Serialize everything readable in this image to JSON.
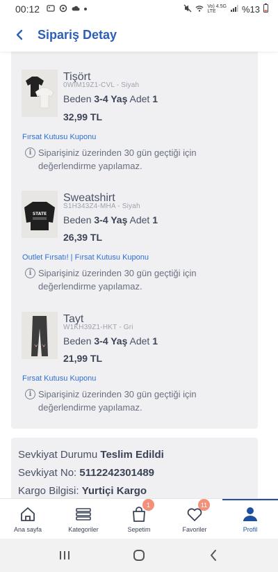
{
  "status": {
    "time": "00:12",
    "battery": "%13",
    "net_top": "Vo) 4.5G",
    "net_bottom": "LTE"
  },
  "header": {
    "title": "Sipariş Detay"
  },
  "items": [
    {
      "name": "Tişört",
      "code": "0WIM19Z1-CVL - Siyah",
      "size_label": "Beden",
      "size": "3-4 Yaş",
      "qty_label": "Adet",
      "qty": "1",
      "price": "32,99 TL",
      "coupon": "Fırsat Kutusu Kuponu",
      "info": "Siparişiniz üzerinden 30 gün geçtiği için değerlendirme yapılamaz."
    },
    {
      "name": "Sweatshirt",
      "code": "S1H343Z4-MHA - Siyah",
      "size_label": "Beden",
      "size": "3-4 Yaş",
      "qty_label": "Adet",
      "qty": "1",
      "price": "26,39 TL",
      "coupon": "Outlet Fırsatı! | Fırsat Kutusu Kuponu",
      "info": "Siparişiniz üzerinden 30 gün geçtiği için değerlendirme yapılamaz."
    },
    {
      "name": "Tayt",
      "code": "W1KH39Z1-HKT - Gri",
      "size_label": "Beden",
      "size": "3-4 Yaş",
      "qty_label": "Adet",
      "qty": "1",
      "price": "21,99 TL",
      "coupon": "Fırsat Kutusu Kuponu",
      "info": "Siparişiniz üzerinden 30 gün geçtiği için değerlendirme yapılamaz."
    }
  ],
  "shipping": {
    "status_label": "Sevkiyat Durumu",
    "status_value": "Teslim Edildi",
    "no_label": "Sevkiyat No:",
    "no_value": "5112242301489",
    "cargo_label": "Kargo Bilgisi:",
    "cargo_value": "Yurtiçi Kargo"
  },
  "nav": [
    {
      "label": "Ana sayfa",
      "icon": "home-icon"
    },
    {
      "label": "Kategoriler",
      "icon": "list-icon"
    },
    {
      "label": "Sepetim",
      "icon": "bag-icon",
      "badge": "1"
    },
    {
      "label": "Favoriler",
      "icon": "heart-icon",
      "badge": "11"
    },
    {
      "label": "Profil",
      "icon": "user-icon",
      "active": true
    }
  ],
  "colors": {
    "accent": "#2d5fb8",
    "link": "#2d6fd6",
    "badge": "#f3907a",
    "card": "#f0f0f2"
  }
}
